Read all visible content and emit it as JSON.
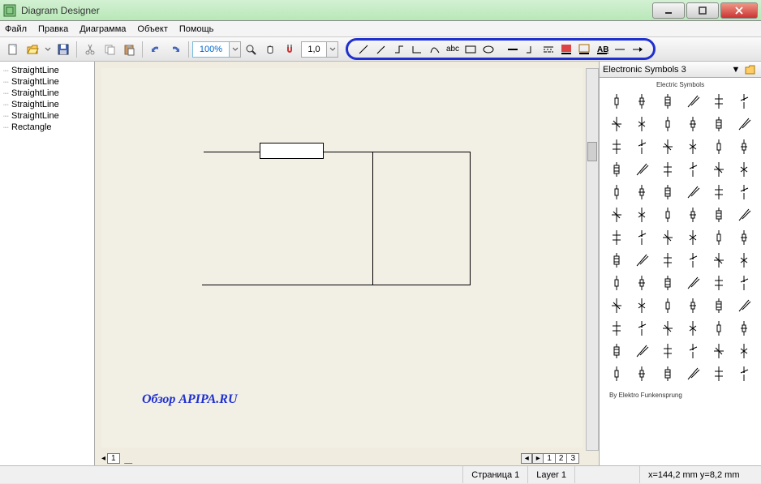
{
  "window": {
    "title": "Diagram Designer"
  },
  "menu": {
    "file": "Файл",
    "edit": "Правка",
    "diagram": "Диаграмма",
    "object": "Объект",
    "help": "Помощь"
  },
  "toolbar": {
    "zoom": "100%",
    "snap": "1,0"
  },
  "tree": {
    "items": [
      "StraightLine",
      "StraightLine",
      "StraightLine",
      "StraightLine",
      "StraightLine",
      "Rectangle"
    ]
  },
  "canvas": {
    "watermark": "Обзор APIPA.RU",
    "left_tab": "1",
    "right_tabs": [
      "1",
      "2",
      "3"
    ]
  },
  "palette": {
    "name": "Electronic Symbols 3",
    "category": "Electric Symbols",
    "credit": "By Elektro Funkensprung"
  },
  "status": {
    "page": "Страница 1",
    "layer": "Layer 1",
    "coords": "x=144,2 mm  y=8,2 mm"
  }
}
